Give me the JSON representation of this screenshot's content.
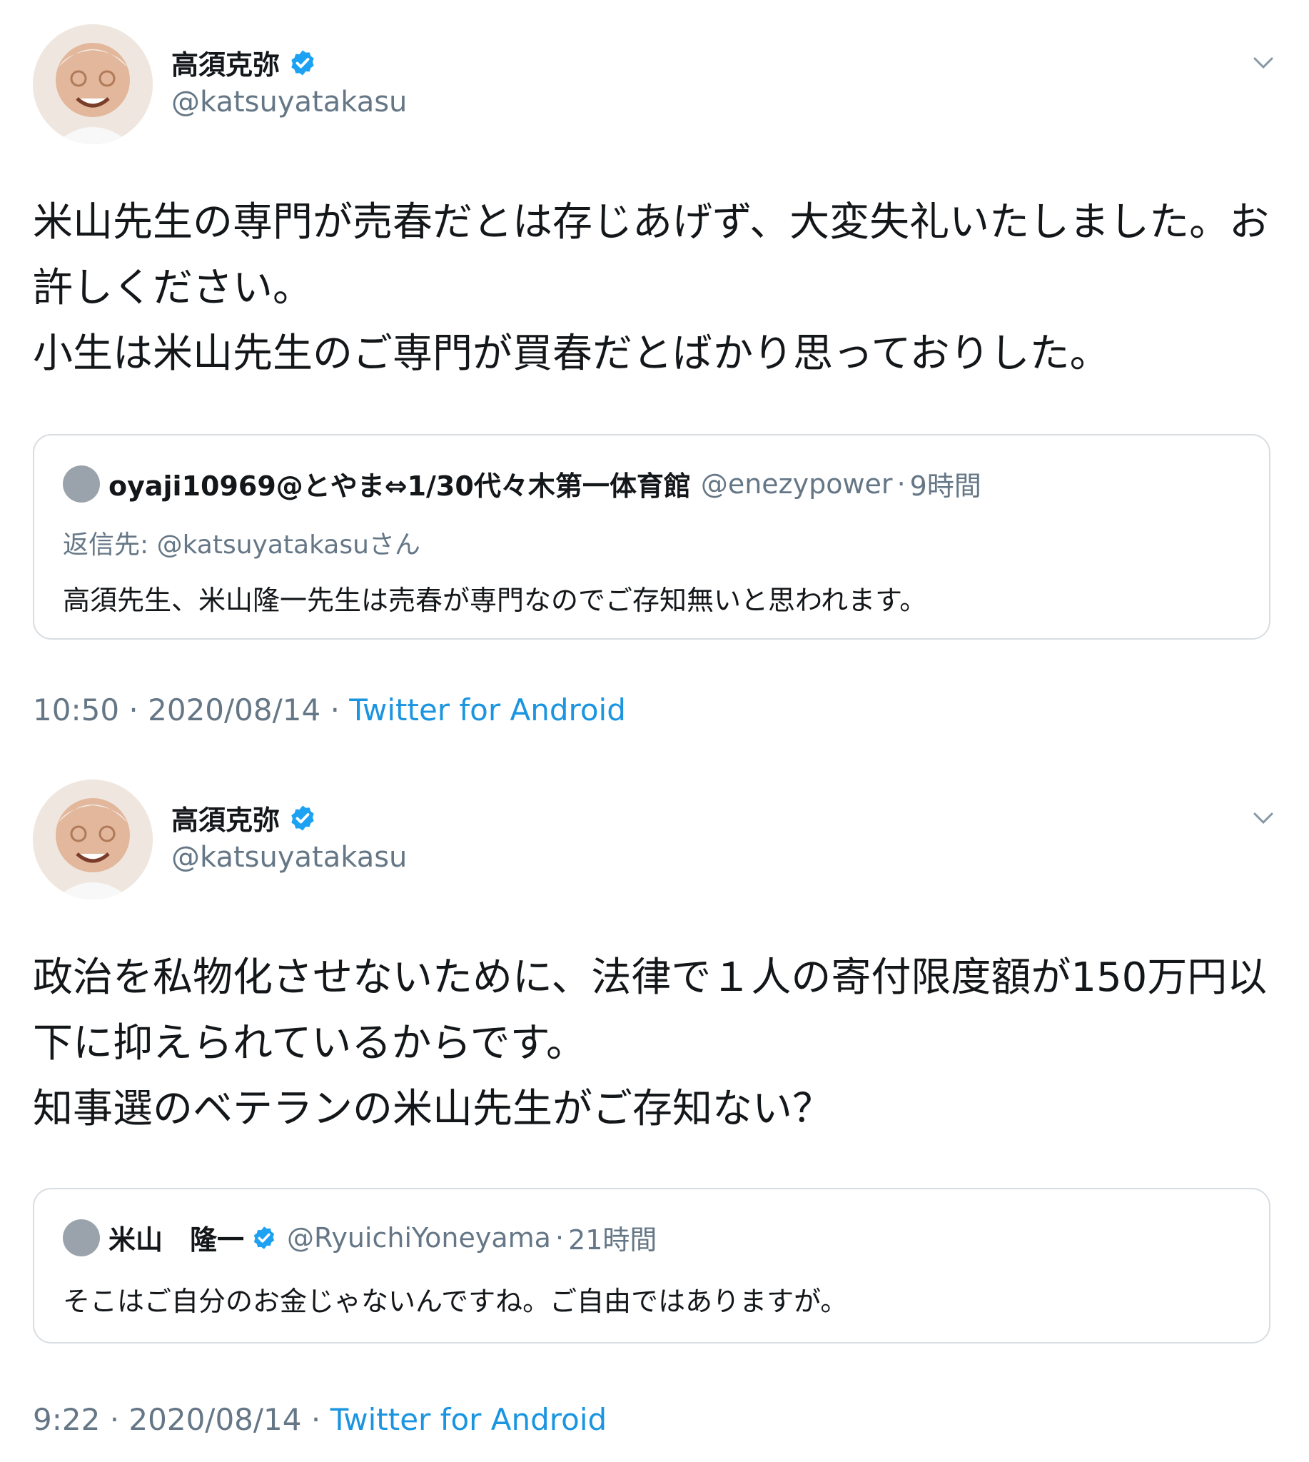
{
  "tweets": [
    {
      "author_name": "高須克弥",
      "author_handle": "@katsuyatakasu",
      "text": "米山先生の専門が売春だとは存じあげず、大変失礼いたしました。お許しください。\n小生は米山先生のご専門が買春だとばかり思っておりした。",
      "quoted": {
        "name": "oyaji10969@とやま⇔1/30代々木第一体育館",
        "handle": "@enezypower",
        "time": "9時間",
        "reply_to": "返信先: @katsuyatakasuさん",
        "text": "高須先生、米山隆一先生は売春が専門なのでご存知無いと思われます。"
      },
      "time": "10:50",
      "date": "2020/08/14",
      "source": "Twitter for Android"
    },
    {
      "author_name": "高須克弥",
      "author_handle": "@katsuyatakasu",
      "text": "政治を私物化させないために、法律で１人の寄付限度額が150万円以下に抑えられているからです。\n知事選のベテランの米山先生がご存知ない？",
      "quoted": {
        "name": "米山　隆一",
        "handle": "@RyuichiYoneyama",
        "time": "21時間",
        "text": "そこはご自分のお金じゃないんですね。ご自由ではありますが。"
      },
      "time": "9:22",
      "date": "2020/08/14",
      "source": "Twitter for Android"
    }
  ],
  "separator": "·",
  "icons": {
    "verified": "verified-badge-icon",
    "menu": "chevron-down-icon"
  },
  "colors": {
    "accent": "#1b95e0",
    "verified": "#1da1f2",
    "secondary_text": "#657786",
    "border": "#d8dde2"
  }
}
